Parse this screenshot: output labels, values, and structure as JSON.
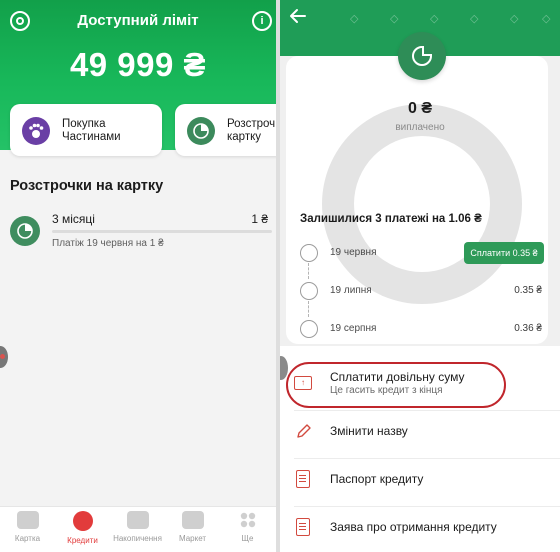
{
  "left": {
    "header": {
      "title": "Доступний ліміт",
      "amount": "49 999 ₴"
    },
    "tiles": [
      {
        "line1": "Покупка",
        "line2": "Частинами",
        "icon": "paw-icon"
      },
      {
        "line1": "Розстроч",
        "line2": "картку",
        "icon": "pie-chart-icon"
      }
    ],
    "section_title": "Розстрочки на картку",
    "installment": {
      "title": "3 місяці",
      "amount": "1 ₴",
      "subtitle": "Платіж 19 червня на 1 ₴"
    },
    "tabs": [
      {
        "label": "Картка",
        "icon": "card-icon"
      },
      {
        "label": "Кредити",
        "icon": "credit-pie-icon",
        "active": true
      },
      {
        "label": "Накопичення",
        "icon": "savings-icon"
      },
      {
        "label": "Маркет",
        "icon": "bag-icon"
      },
      {
        "label": "Ще",
        "icon": "more-icon"
      }
    ]
  },
  "right": {
    "paid": {
      "amount": "0 ₴",
      "label": "виплачено",
      "fraction": 0
    },
    "remaining_title": "Залишилися 3 платежі на 1.06 ₴",
    "schedule": [
      {
        "date": "19 червня",
        "amount": "",
        "button": "Сплатити 0.35 ₴"
      },
      {
        "date": "19 липня",
        "amount": "0.35 ₴"
      },
      {
        "date": "19 серпня",
        "amount": "0.36 ₴"
      }
    ],
    "actions": [
      {
        "label": "Сплатити довільну суму",
        "sub": "Це гасить кредит з кінця",
        "icon": "pay-any-icon"
      },
      {
        "label": "Змінити назву",
        "icon": "pencil-icon"
      },
      {
        "label": "Паспорт кредиту",
        "icon": "document-icon"
      },
      {
        "label": "Заява про отримання кредиту",
        "icon": "document-icon"
      }
    ]
  },
  "colors": {
    "brand_green": "#1f9d57",
    "accent_red": "#e23b3b",
    "highlight_red": "#c0262c"
  }
}
